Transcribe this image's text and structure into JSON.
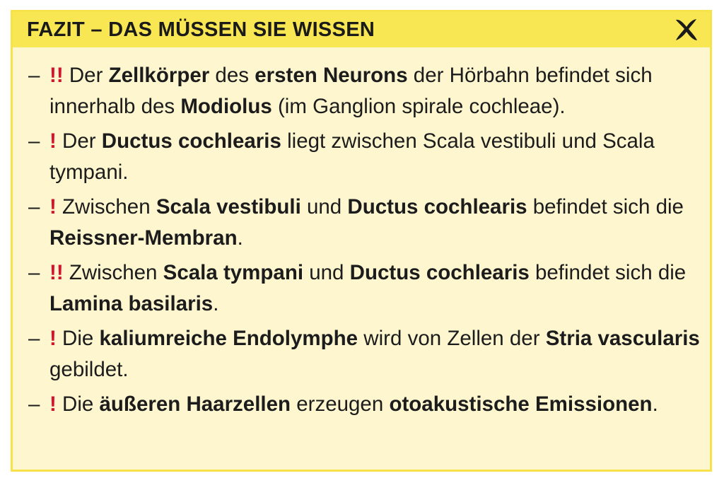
{
  "header": {
    "title": "FAZIT – DAS MÜSSEN SIE WISSEN",
    "close_icon": "close-x-icon"
  },
  "colors": {
    "header_bg": "#f9e653",
    "box_bg": "#fdf6cf",
    "mark": "#d8102d"
  },
  "items": [
    {
      "dash": "–",
      "mark": "!!",
      "parts": [
        {
          "t": " Der ",
          "b": false
        },
        {
          "t": "Zellkörper",
          "b": true
        },
        {
          "t": " des ",
          "b": false
        },
        {
          "t": "ersten Neurons",
          "b": true
        },
        {
          "t": " der Hörbahn befindet sich innerhalb des ",
          "b": false
        },
        {
          "t": "Modiolus",
          "b": true
        },
        {
          "t": " (im Ganglion spirale cochleae).",
          "b": false
        }
      ]
    },
    {
      "dash": "–",
      "mark": "!",
      "parts": [
        {
          "t": " Der ",
          "b": false
        },
        {
          "t": "Ductus cochlearis",
          "b": true
        },
        {
          "t": " liegt zwischen Scala vestibuli und Scala tympani.",
          "b": false
        }
      ]
    },
    {
      "dash": "–",
      "mark": "!",
      "parts": [
        {
          "t": " Zwischen ",
          "b": false
        },
        {
          "t": "Scala vestibuli",
          "b": true
        },
        {
          "t": " und ",
          "b": false
        },
        {
          "t": "Ductus cochlearis",
          "b": true
        },
        {
          "t": " befindet sich die ",
          "b": false
        },
        {
          "t": "Reissner-Membran",
          "b": true
        },
        {
          "t": ".",
          "b": false
        }
      ]
    },
    {
      "dash": "–",
      "mark": "!!",
      "parts": [
        {
          "t": " Zwischen ",
          "b": false
        },
        {
          "t": "Scala tympani",
          "b": true
        },
        {
          "t": " und ",
          "b": false
        },
        {
          "t": "Ductus cochlearis",
          "b": true
        },
        {
          "t": " befindet sich die ",
          "b": false
        },
        {
          "t": "Lamina basilaris",
          "b": true
        },
        {
          "t": ".",
          "b": false
        }
      ]
    },
    {
      "dash": "–",
      "mark": "!",
      "parts": [
        {
          "t": " Die ",
          "b": false
        },
        {
          "t": "kaliumreiche Endolymphe",
          "b": true
        },
        {
          "t": " wird von Zellen der ",
          "b": false
        },
        {
          "t": "Stria vas­cularis",
          "b": true
        },
        {
          "t": " gebildet.",
          "b": false
        }
      ]
    },
    {
      "dash": "–",
      "mark": "!",
      "parts": [
        {
          "t": " Die ",
          "b": false
        },
        {
          "t": "äußeren Haarzellen",
          "b": true
        },
        {
          "t": " erzeugen ",
          "b": false
        },
        {
          "t": "otoakustische Emissio­nen",
          "b": true
        },
        {
          "t": ".",
          "b": false
        }
      ]
    }
  ]
}
